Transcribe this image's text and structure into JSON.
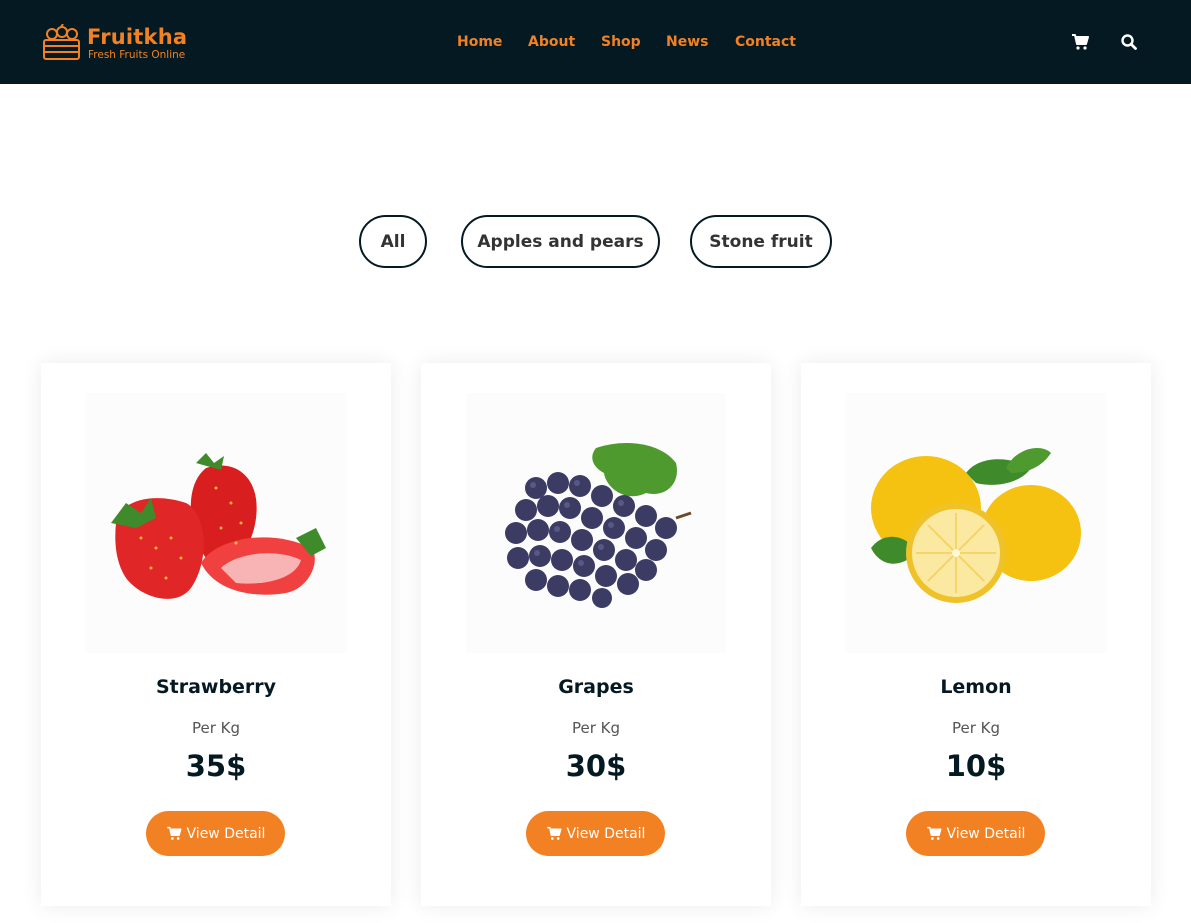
{
  "brand": {
    "name": "Fruitkha",
    "tagline": "Fresh Fruits Online",
    "accent_color": "#F28123",
    "header_bg": "#051922"
  },
  "nav": {
    "items": [
      {
        "label": "Home"
      },
      {
        "label": "About"
      },
      {
        "label": "Shop"
      },
      {
        "label": "News"
      },
      {
        "label": "Contact"
      }
    ],
    "cart_icon": "cart-icon",
    "search_icon": "search-icon"
  },
  "filters": [
    {
      "label": "All"
    },
    {
      "label": "Apples and pears"
    },
    {
      "label": "Stone fruit"
    }
  ],
  "products": [
    {
      "name": "Strawberry",
      "unit": "Per Kg",
      "price": "35$",
      "button": "View Detail",
      "image": "strawberry-image"
    },
    {
      "name": "Grapes",
      "unit": "Per Kg",
      "price": "30$",
      "button": "View Detail",
      "image": "grapes-image"
    },
    {
      "name": "Lemon",
      "unit": "Per Kg",
      "price": "10$",
      "button": "View Detail",
      "image": "lemon-image"
    }
  ]
}
